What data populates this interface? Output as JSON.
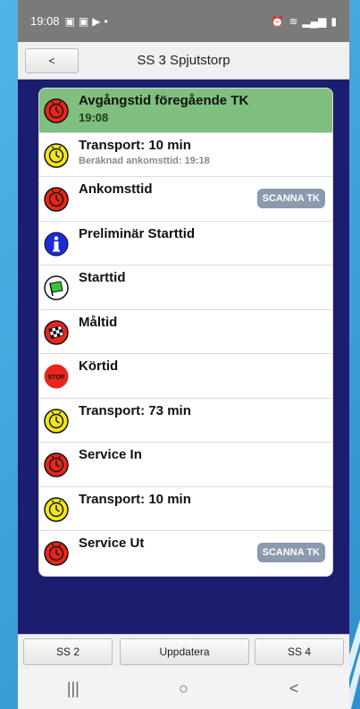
{
  "statusbar": {
    "time": "19:08",
    "icons": [
      "gallery-icon",
      "gallery-icon",
      "youtube-icon",
      "dot-icon"
    ],
    "right": [
      "alarm-icon",
      "wifi-icon",
      "signal-icon",
      "battery-icon"
    ]
  },
  "header": {
    "back_label": "<",
    "title": "SS 3 Spjutstorp"
  },
  "list": [
    {
      "icon": "red-clock-icon",
      "title": "Avgångstid föregående TK",
      "sub": "19:08",
      "highlight": true,
      "button": ""
    },
    {
      "icon": "yellow-clock-icon",
      "title": "Transport: 10 min",
      "sub": "Beräknad ankomsttid: 19:18",
      "highlight": false,
      "button": ""
    },
    {
      "icon": "red-clock-icon",
      "title": "Ankomsttid",
      "sub": "",
      "highlight": false,
      "button": "SCANNA TK"
    },
    {
      "icon": "info-icon",
      "title": "Preliminär Starttid",
      "sub": "",
      "highlight": false,
      "button": ""
    },
    {
      "icon": "green-flag-icon",
      "title": "Starttid",
      "sub": "",
      "highlight": false,
      "button": ""
    },
    {
      "icon": "checkered-flag-icon",
      "title": "Måltid",
      "sub": "",
      "highlight": false,
      "button": ""
    },
    {
      "icon": "stop-icon",
      "title": "Körtid",
      "sub": "",
      "highlight": false,
      "button": ""
    },
    {
      "icon": "yellow-clock-icon",
      "title": "Transport: 73 min",
      "sub": "",
      "highlight": false,
      "button": ""
    },
    {
      "icon": "red-clock-icon",
      "title": "Service In",
      "sub": "",
      "highlight": false,
      "button": ""
    },
    {
      "icon": "yellow-clock-icon",
      "title": "Transport: 10 min",
      "sub": "",
      "highlight": false,
      "button": ""
    },
    {
      "icon": "red-clock-icon",
      "title": "Service Ut",
      "sub": "",
      "highlight": false,
      "button": "SCANNA TK"
    }
  ],
  "footer": {
    "prev": "SS 2",
    "update": "Uppdatera",
    "next": "SS 4"
  },
  "navbar": {
    "recent": "|||",
    "home": "○",
    "back": "<"
  },
  "colors": {
    "app_bg": "#1b1d6e",
    "highlight": "#7fbf7f",
    "scan_button": "#8c9aaf",
    "red": "#e8261c",
    "yellow": "#f2e51a",
    "blue": "#1d2bd6"
  }
}
